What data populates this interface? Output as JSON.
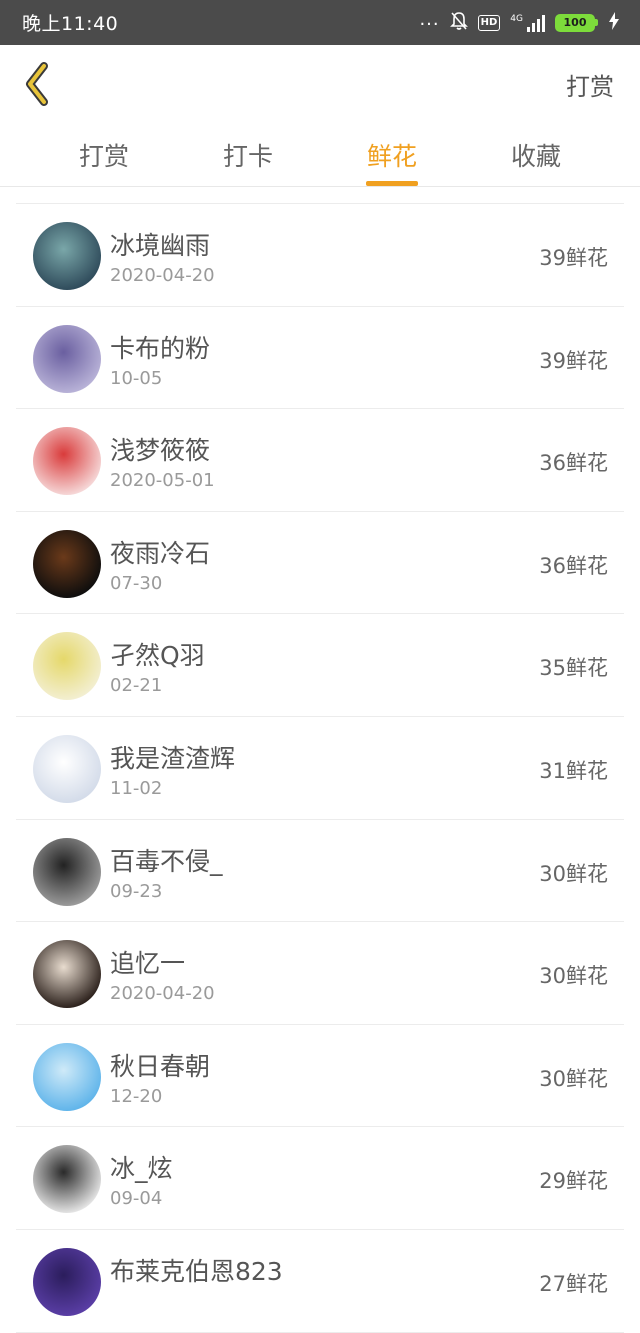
{
  "statusbar": {
    "time": "晚上11:40",
    "dots": "...",
    "hd": "HD",
    "network": "4G",
    "battery": "100"
  },
  "navbar": {
    "title_right": "打赏"
  },
  "tabs": [
    {
      "label": "打赏",
      "active": false
    },
    {
      "label": "打卡",
      "active": false
    },
    {
      "label": "鲜花",
      "active": true
    },
    {
      "label": "收藏",
      "active": false
    }
  ],
  "list": [
    {
      "name": "冰境幽雨",
      "date": "2020-04-20",
      "count": "39鲜花",
      "avatar_color_a": "#2e4a5a",
      "avatar_color_b": "#7aa7a9"
    },
    {
      "name": "卡布的粉",
      "date": "10-05",
      "count": "39鲜花",
      "avatar_color_a": "#b9b3d8",
      "avatar_color_b": "#6a5fa0"
    },
    {
      "name": "浅梦筱筱",
      "date": "2020-05-01",
      "count": "36鲜花",
      "avatar_color_a": "#f6d9d9",
      "avatar_color_b": "#d93b3b"
    },
    {
      "name": "夜雨冷石",
      "date": "07-30",
      "count": "36鲜花",
      "avatar_color_a": "#0d0d0d",
      "avatar_color_b": "#6b3a1a"
    },
    {
      "name": "孑然Q羽",
      "date": "02-21",
      "count": "35鲜花",
      "avatar_color_a": "#f3efd2",
      "avatar_color_b": "#e5d86a"
    },
    {
      "name": "我是渣渣辉",
      "date": "11-02",
      "count": "31鲜花",
      "avatar_color_a": "#d3dbe9",
      "avatar_color_b": "#ffffff"
    },
    {
      "name": "百毒不侵_",
      "date": "09-23",
      "count": "30鲜花",
      "avatar_color_a": "#9c9c9c",
      "avatar_color_b": "#222222"
    },
    {
      "name": "追忆一",
      "date": "2020-04-20",
      "count": "30鲜花",
      "avatar_color_a": "#2a1f1a",
      "avatar_color_b": "#e8dccf"
    },
    {
      "name": "秋日春朝",
      "date": "12-20",
      "count": "30鲜花",
      "avatar_color_a": "#5fb4ea",
      "avatar_color_b": "#cfeaf8"
    },
    {
      "name": "冰_炫",
      "date": "09-04",
      "count": "29鲜花",
      "avatar_color_a": "#e6e6e6",
      "avatar_color_b": "#2a2a2a"
    },
    {
      "name": "布莱克伯恩823",
      "date": "",
      "count": "27鲜花",
      "avatar_color_a": "#5a3ea6",
      "avatar_color_b": "#2b1d5c"
    }
  ],
  "colors": {
    "accent": "#f0a020",
    "statusbar": "#4b4b4b",
    "back_icon": "#e8c43a"
  }
}
